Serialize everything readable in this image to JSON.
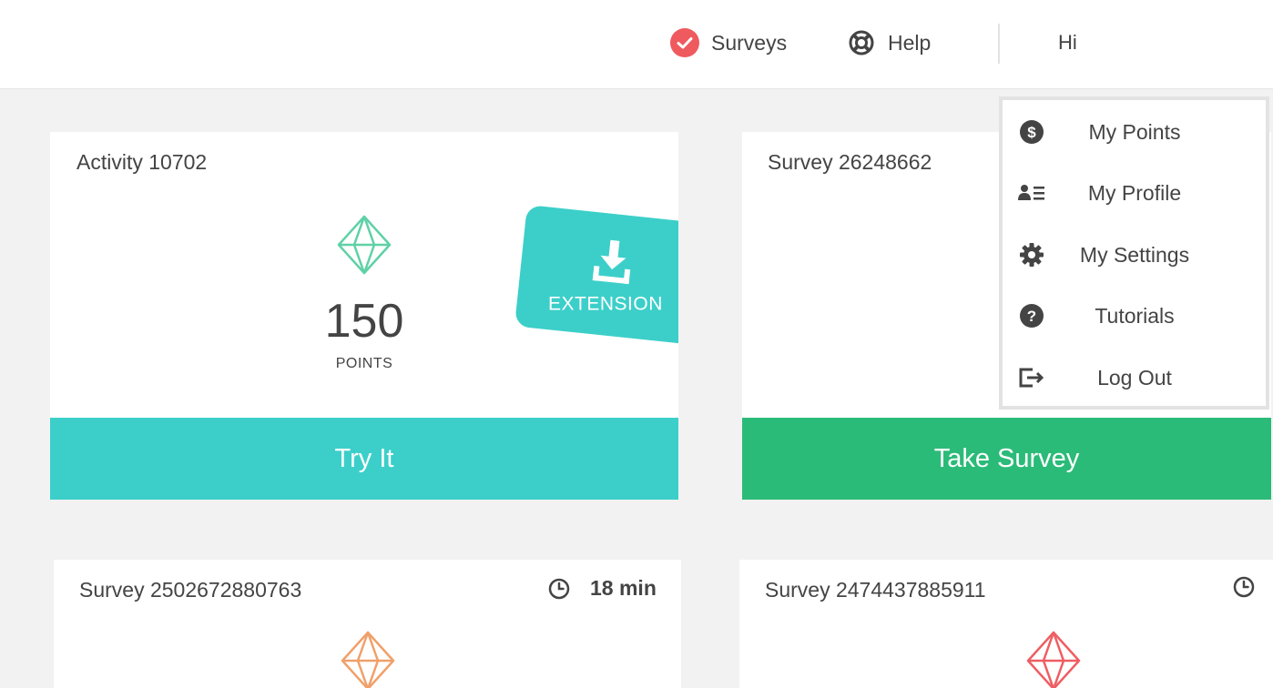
{
  "header": {
    "surveys_label": "Surveys",
    "help_label": "Help",
    "greeting": "Hi"
  },
  "cards": [
    {
      "title": "Activity 10702",
      "points": "150",
      "points_label": "POINTS",
      "badge_label": "EXTENSION",
      "cta_label": "Try It",
      "gem_color": "#5fd1a6",
      "cta_color": "#3ccfc9"
    },
    {
      "title": "Survey 26248662",
      "cta_label": "Take Survey",
      "cta_color": "#2bbb78"
    },
    {
      "title": "Survey 2502672880763",
      "time": "18 min",
      "gem_color": "#f0a06a"
    },
    {
      "title": "Survey 2474437885911",
      "gem_color": "#ef5e63"
    }
  ],
  "dropdown": {
    "items": [
      {
        "label": "My Points",
        "icon": "dollar-circle-icon"
      },
      {
        "label": "My Profile",
        "icon": "id-card-icon"
      },
      {
        "label": "My Settings",
        "icon": "gear-icon"
      },
      {
        "label": "Tutorials",
        "icon": "question-circle-icon"
      },
      {
        "label": "Log Out",
        "icon": "logout-icon"
      }
    ]
  },
  "colors": {
    "accent_teal": "#3ccfc9",
    "accent_green": "#2bbb78",
    "check_red": "#ef5a5f"
  }
}
